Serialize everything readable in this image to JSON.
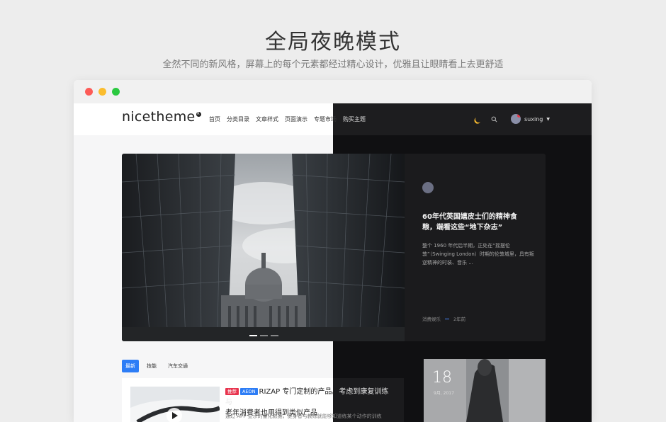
{
  "hero": {
    "title": "全局夜晚模式",
    "subtitle": "全然不同的新风格，屏幕上的每个元素都经过精心设计，优雅且让眼睛看上去更舒适"
  },
  "site": {
    "logo": "nicetheme",
    "menu": [
      "首页",
      "分类目录",
      "文章样式",
      "页面演示",
      "专题市场",
      "购买主题"
    ],
    "username": "suxing"
  },
  "feature": {
    "title": "60年代英国嬉皮士们的精神食粮，端看这些“地下杂志”",
    "excerpt": "整个 1960 年代后半期，正处在“摇摆伦敦”（Swinging London）时期的伦敦城里，具有叛逆精神的时装、音乐 ...",
    "category": "消费娱乐",
    "time": "2年前"
  },
  "tabs": [
    "最新",
    "技能",
    "汽车交通"
  ],
  "post": {
    "badge1": "推荐",
    "badge2": "AEON",
    "title_light": "RIZAP 专门定制的产品。",
    "title_dark": "考虑到康复训练与",
    "title_line2": "老年消费者也用得到类似产品",
    "excerpt_light": "通过 APP 显示的量化数据，健身者与教练就",
    "excerpt_dark": "能够知道练某个动作的训练"
  },
  "side_card": {
    "day": "18",
    "month": "9月, 2017"
  },
  "colors": {
    "accent": "#2d7df6",
    "badge_red": "#e8344e",
    "moon": "#f5b82e",
    "dark_bg": "#101012"
  }
}
